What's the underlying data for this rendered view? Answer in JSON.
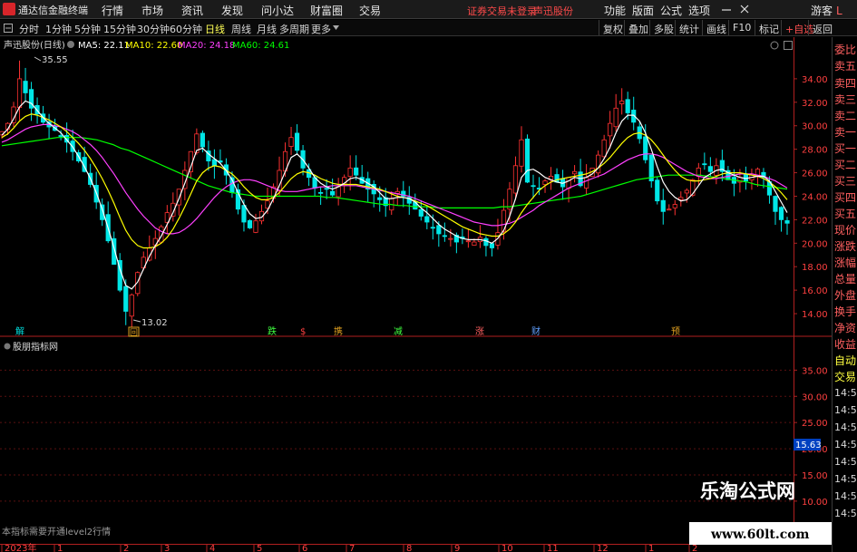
{
  "titlebar": {
    "app_title": "通达信金融终端",
    "menus": [
      "行情",
      "市场",
      "资讯",
      "发现",
      "问小达",
      "财富圈",
      "交易"
    ],
    "warning": "证券交易未登录",
    "stock": "声迅股份",
    "right_menus": [
      "功能",
      "版面",
      "公式",
      "选项"
    ],
    "user": "游客"
  },
  "toolbar": {
    "periods": [
      "分时",
      "1分钟",
      "5分钟",
      "15分钟",
      "30分钟",
      "60分钟",
      "日线",
      "周线",
      "月线",
      "多周期",
      "更多"
    ],
    "active_period": "日线",
    "actions": [
      "复权",
      "叠加",
      "多股",
      "统计",
      "画线",
      "F10",
      "标记",
      "+自选",
      "返回"
    ]
  },
  "side_panel": {
    "items": [
      "委比",
      "卖五",
      "卖四",
      "卖三",
      "卖二",
      "卖一",
      "买一",
      "买二",
      "买三",
      "买四",
      "买五",
      "现价",
      "涨跌",
      "涨幅",
      "总量",
      "外盘",
      "换手",
      "净资",
      "收益"
    ],
    "bottom_items": [
      "自动",
      "交易"
    ],
    "times": [
      "14:55",
      "14:55",
      "14:56",
      "14:56",
      "14:56",
      "14:56",
      "14:56",
      "14:56"
    ],
    "corner": "L"
  },
  "chart": {
    "stock_label": "声迅股份(日线)",
    "ma_labels": [
      "MA5: 22.11",
      "MA10: 22.60",
      "MA20: 24.18",
      "MA60: 24.61"
    ],
    "ma_colors": [
      "#ffffff",
      "#ffff00",
      "#ff40ff",
      "#00ff00"
    ],
    "up_color": "#ff3232",
    "down_color": "#00e6e6",
    "high_label": "35.55",
    "low_label": "13.02",
    "event_markers": [
      "解",
      "回",
      "跌",
      "$",
      "携",
      "减",
      "涨",
      "财",
      "预"
    ],
    "indicator_name": "股朋指标网",
    "level2_note": "本指标需要开通level2行情",
    "current_price_tag": "15.63",
    "xaxis_labels": [
      "2023年",
      "1",
      "2",
      "3",
      "4",
      "5",
      "6",
      "7",
      "8",
      "9",
      "10",
      "11",
      "12",
      "1",
      "2"
    ],
    "watermark_title": "乐淘公式网",
    "watermark_url": "www.60lt.com"
  },
  "chart_data": {
    "type": "candlestick",
    "title": "声迅股份(日线)",
    "price_axis_ticks": [
      34,
      32,
      30,
      28,
      26,
      24,
      22,
      20,
      18,
      16,
      14
    ],
    "price_axis_labels": [
      "34.00",
      "32.00",
      "30.00",
      "28.00",
      "26.00",
      "24.00",
      "22.00",
      "20.00",
      "18.00",
      "16.00",
      "14.00"
    ],
    "ylim": [
      13.0,
      36.0
    ],
    "indicator_axis_ticks": [
      35,
      30,
      25,
      20,
      15,
      10
    ],
    "indicator_axis_labels": [
      "35.00",
      "30.00",
      "25.00",
      "20.00",
      "15.00",
      "10.00"
    ],
    "indicator_ylim": [
      6.0,
      38.0
    ],
    "close_path": [
      29.5,
      30.2,
      31.6,
      34.0,
      32.8,
      31.5,
      31.0,
      30.3,
      29.9,
      29.6,
      29.1,
      28.6,
      27.8,
      27.0,
      26.1,
      25.0,
      23.5,
      22.0,
      20.2,
      18.2,
      16.0,
      14.2,
      15.6,
      17.5,
      18.8,
      19.6,
      20.4,
      21.4,
      22.6,
      23.4,
      24.6,
      26.2,
      27.8,
      29.3,
      28.2,
      27.0,
      26.6,
      26.9,
      25.8,
      24.3,
      22.9,
      21.8,
      21.3,
      21.9,
      22.7,
      23.6,
      24.8,
      26.2,
      27.8,
      29.0,
      27.9,
      26.4,
      25.6,
      24.7,
      24.3,
      24.6,
      24.1,
      24.8,
      25.6,
      26.4,
      25.8,
      25.1,
      24.6,
      24.2,
      23.7,
      23.2,
      23.8,
      24.4,
      24.0,
      23.4,
      22.9,
      22.3,
      21.8,
      21.3,
      20.8,
      20.6,
      20.4,
      20.1,
      20.4,
      20.2,
      20.1,
      20.5,
      19.8,
      19.6,
      20.9,
      22.8,
      24.6,
      26.6,
      28.8,
      25.2,
      24.9,
      24.6,
      25.3,
      25.7,
      25.2,
      24.8,
      25.6,
      26.1,
      24.9,
      25.6,
      26.4,
      27.5,
      28.8,
      30.2,
      31.5,
      32.1,
      31.1,
      30.3,
      28.9,
      27.1,
      25.3,
      23.6,
      22.7,
      22.9,
      23.3,
      23.9,
      24.5,
      25.4,
      26.4,
      26.7,
      26.1,
      26.6,
      26.1,
      25.4,
      25.1,
      25.6,
      25.3,
      25.9,
      26.3,
      25.6,
      24.1,
      22.7,
      22.0,
      21.7
    ],
    "ma5_path": [
      29.2,
      29.7,
      30.6,
      31.6,
      32.1,
      31.9,
      31.3,
      30.7,
      30.2,
      29.8,
      29.4,
      28.8,
      28.2,
      27.4,
      26.5,
      25.5,
      24.3,
      22.9,
      21.3,
      19.6,
      17.8,
      16.4,
      16.1,
      16.7,
      17.8,
      18.9,
      19.8,
      20.6,
      21.6,
      22.6,
      23.8,
      25.1,
      26.5,
      27.9,
      28.1,
      27.6,
      27.2,
      26.8,
      26.2,
      25.4,
      24.3,
      23.3,
      22.5,
      22.1,
      22.2,
      22.8,
      23.8,
      24.9,
      26.1,
      27.3,
      27.6,
      27.1,
      26.4,
      25.6,
      25.1,
      24.8,
      24.6,
      24.8,
      25.1,
      25.5,
      25.6,
      25.4,
      25.1,
      24.8,
      24.3,
      23.8,
      23.8,
      23.9,
      23.9,
      23.8,
      23.5,
      23.0,
      22.6,
      22.1,
      21.6,
      21.2,
      20.9,
      20.6,
      20.4,
      20.3,
      20.3,
      20.3,
      20.2,
      20.0,
      20.4,
      21.1,
      22.3,
      23.8,
      25.6,
      26.2,
      26.3,
      26.0,
      25.6,
      25.4,
      25.2,
      25.1,
      25.3,
      25.6,
      25.5,
      25.6,
      25.9,
      26.4,
      27.2,
      28.2,
      29.4,
      30.4,
      30.9,
      30.9,
      30.4,
      29.4,
      28.0,
      26.5,
      25.2,
      24.4,
      23.9,
      23.6,
      23.7,
      24.2,
      24.9,
      25.6,
      25.9,
      26.2,
      26.3,
      26.0,
      25.8,
      25.6,
      25.5,
      25.6,
      25.7,
      25.7,
      25.3,
      24.4,
      23.5,
      22.6
    ],
    "ma10_path": [
      29.0,
      29.3,
      29.8,
      30.4,
      30.8,
      31.0,
      30.9,
      30.7,
      30.5,
      30.2,
      29.9,
      29.5,
      29.0,
      28.5,
      27.9,
      27.2,
      26.4,
      25.5,
      24.5,
      23.4,
      22.2,
      21.1,
      20.3,
      19.8,
      19.6,
      19.6,
      19.7,
      20.0,
      20.5,
      21.2,
      22.1,
      23.1,
      24.2,
      25.3,
      26.0,
      26.4,
      26.6,
      26.5,
      26.2,
      25.9,
      25.4,
      24.8,
      24.3,
      23.9,
      23.7,
      23.7,
      23.9,
      24.3,
      24.9,
      25.5,
      25.9,
      26.1,
      26.0,
      25.8,
      25.5,
      25.3,
      25.1,
      25.0,
      25.0,
      25.0,
      25.0,
      24.9,
      24.8,
      24.7,
      24.6,
      24.4,
      24.2,
      24.0,
      23.9,
      23.8,
      23.6,
      23.4,
      23.2,
      22.9,
      22.6,
      22.3,
      22.0,
      21.7,
      21.4,
      21.2,
      21.0,
      20.8,
      20.7,
      20.6,
      20.6,
      20.8,
      21.2,
      21.8,
      22.6,
      23.3,
      23.9,
      24.5,
      24.9,
      25.2,
      25.4,
      25.5,
      25.6,
      25.7,
      25.8,
      25.9,
      26.1,
      26.4,
      26.8,
      27.3,
      27.9,
      28.5,
      29.0,
      29.3,
      29.4,
      29.2,
      28.8,
      28.2,
      27.5,
      26.8,
      26.2,
      25.7,
      25.4,
      25.3,
      25.3,
      25.4,
      25.5,
      25.7,
      25.9,
      26.0,
      26.0,
      26.0,
      25.9,
      25.8,
      25.7,
      25.5,
      25.2,
      24.8,
      24.3,
      23.7
    ],
    "ma20_path": [
      28.6,
      28.8,
      29.1,
      29.4,
      29.7,
      29.9,
      30.0,
      30.1,
      30.1,
      30.0,
      29.9,
      29.7,
      29.5,
      29.2,
      28.8,
      28.4,
      27.9,
      27.3,
      26.6,
      25.9,
      25.1,
      24.3,
      23.6,
      22.9,
      22.3,
      21.8,
      21.3,
      21.0,
      20.8,
      20.8,
      20.9,
      21.2,
      21.6,
      22.1,
      22.7,
      23.3,
      23.9,
      24.4,
      24.8,
      25.1,
      25.3,
      25.4,
      25.4,
      25.3,
      25.1,
      24.9,
      24.7,
      24.5,
      24.4,
      24.4,
      24.4,
      24.5,
      24.6,
      24.7,
      24.8,
      24.8,
      24.9,
      24.9,
      24.9,
      24.9,
      24.9,
      24.8,
      24.7,
      24.6,
      24.5,
      24.4,
      24.3,
      24.2,
      24.1,
      24.0,
      23.8,
      23.6,
      23.4,
      23.2,
      23.0,
      22.8,
      22.6,
      22.4,
      22.2,
      22.0,
      21.8,
      21.7,
      21.6,
      21.5,
      21.5,
      21.6,
      21.7,
      21.9,
      22.2,
      22.5,
      22.8,
      23.2,
      23.5,
      23.8,
      24.1,
      24.4,
      24.7,
      24.9,
      25.1,
      25.3,
      25.5,
      25.7,
      25.9,
      26.2,
      26.5,
      26.8,
      27.1,
      27.3,
      27.5,
      27.6,
      27.6,
      27.5,
      27.3,
      27.0,
      26.7,
      26.4,
      26.1,
      25.9,
      25.7,
      25.6,
      25.5,
      25.5,
      25.6,
      25.7,
      25.8,
      25.9,
      25.9,
      25.9,
      25.8,
      25.7,
      25.5,
      25.3,
      25.0,
      24.7
    ],
    "ma60_path": [
      28.3,
      28.4,
      28.5,
      28.6,
      28.7,
      28.8,
      28.9,
      29.0,
      29.0,
      29.0,
      29.0,
      28.9,
      28.8,
      28.6,
      28.4,
      28.1,
      27.9,
      27.6,
      27.3,
      27.0,
      26.7,
      26.4,
      26.1,
      25.8,
      25.5,
      25.2,
      24.9,
      24.7,
      24.5,
      24.3,
      24.2,
      24.1,
      24.0,
      24.0,
      24.0,
      24.0,
      24.0,
      24.0,
      24.0,
      24.0,
      24.0,
      23.9,
      23.9,
      23.8,
      23.7,
      23.6,
      23.5,
      23.4,
      23.3,
      23.3,
      23.2,
      23.2,
      23.1,
      23.1,
      23.1,
      23.0,
      23.0,
      23.0,
      23.0,
      23.0,
      23.0,
      23.0,
      23.0,
      23.1,
      23.1,
      23.2,
      23.3,
      23.4,
      23.5,
      23.6,
      23.7,
      23.8,
      23.9,
      24.0,
      24.2,
      24.4,
      24.6,
      24.8,
      25.0,
      25.2,
      25.4,
      25.5,
      25.6,
      25.7,
      25.8,
      25.8,
      25.8,
      25.8,
      25.8,
      25.7,
      25.6,
      25.5,
      25.4,
      25.3,
      25.2,
      25.0,
      24.9,
      24.8,
      24.7,
      24.6
    ]
  }
}
